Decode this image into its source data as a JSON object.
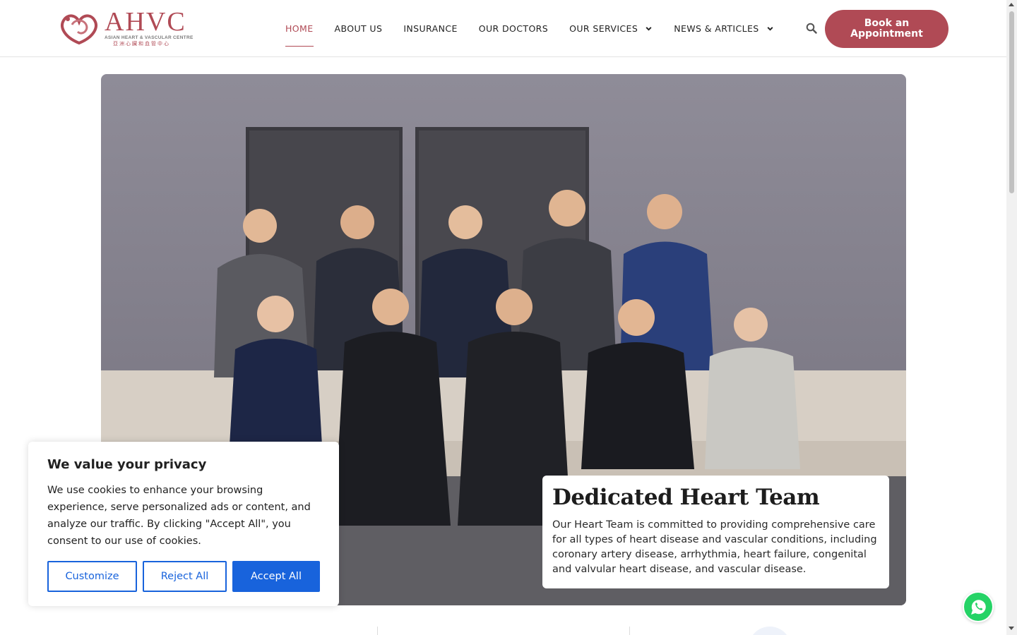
{
  "brand": {
    "name": "AHVC",
    "subtitle": "ASIAN HEART & VASCULAR CENTRE",
    "chinese": "亞洲心臟和血管中心",
    "accent_color": "#b04a55"
  },
  "nav": {
    "items": [
      {
        "label": "HOME",
        "active": true
      },
      {
        "label": "ABOUT US"
      },
      {
        "label": "INSURANCE"
      },
      {
        "label": "OUR DOCTORS"
      },
      {
        "label": "OUR SERVICES",
        "dropdown": true
      },
      {
        "label": "NEWS & ARTICLES",
        "dropdown": true
      }
    ],
    "search_icon": "search-icon",
    "book_button": "Book an Appointment"
  },
  "hero": {
    "image": "team-photo",
    "title": "Dedicated Heart Team",
    "description": "Our Heart Team is committed to providing comprehensive care for all types of heart disease and vascular conditions, including coronary artery disease, arrhythmia, heart failure, congenital and valvular heart disease, and vascular disease."
  },
  "cookie_banner": {
    "title": "We value your privacy",
    "text": "We use cookies to enhance your browsing experience, serve personalized ads or content, and analyze our traffic. By clicking \"Accept All\", you consent to our use of cookies.",
    "customize": "Customize",
    "reject": "Reject All",
    "accept": "Accept All",
    "button_color": "#1863dc"
  },
  "floating": {
    "whatsapp_icon": "whatsapp-icon",
    "whatsapp_color": "#25d366"
  }
}
